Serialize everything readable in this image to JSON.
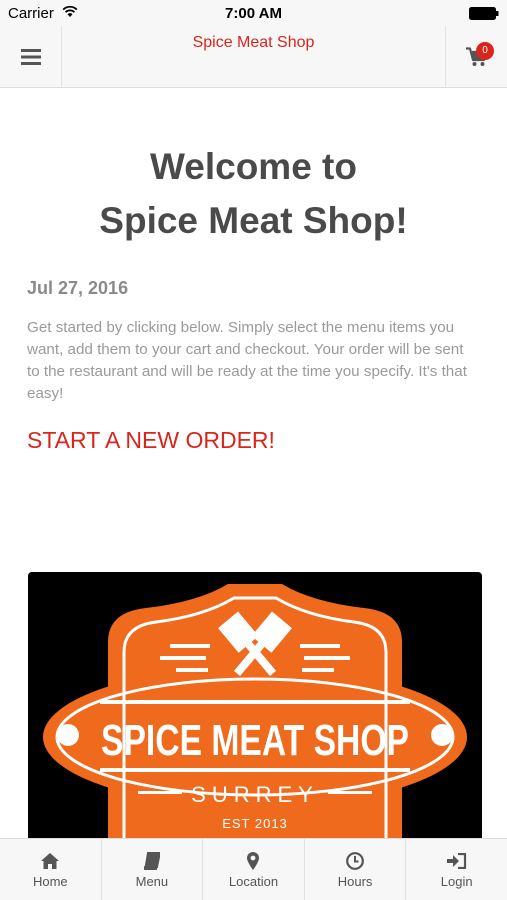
{
  "status_bar": {
    "carrier": "Carrier",
    "time": "7:00 AM"
  },
  "header": {
    "title": "Spice Meat Shop",
    "cart_count": "0"
  },
  "main": {
    "welcome_line1": "Welcome to",
    "welcome_line2": "Spice Meat Shop!",
    "date": "Jul 27, 2016",
    "intro": "Get started by clicking below. Simply select the menu items you want, add them to your cart and checkout. Your order will be sent to the restaurant and will be ready at the time you specify. It's that easy!",
    "cta": "START A NEW ORDER!"
  },
  "logo": {
    "name": "SPICE MEAT SHOP",
    "city": "SURREY",
    "est": "EST 2013"
  },
  "tabs": [
    {
      "label": "Home",
      "icon": "home-icon"
    },
    {
      "label": "Menu",
      "icon": "book-icon"
    },
    {
      "label": "Location",
      "icon": "map-pin-icon"
    },
    {
      "label": "Hours",
      "icon": "clock-icon"
    },
    {
      "label": "Login",
      "icon": "sign-in-icon"
    }
  ],
  "colors": {
    "brand_red": "#d9251c",
    "logo_orange": "#ef6a1c",
    "text_dark": "#4a4a4a"
  }
}
